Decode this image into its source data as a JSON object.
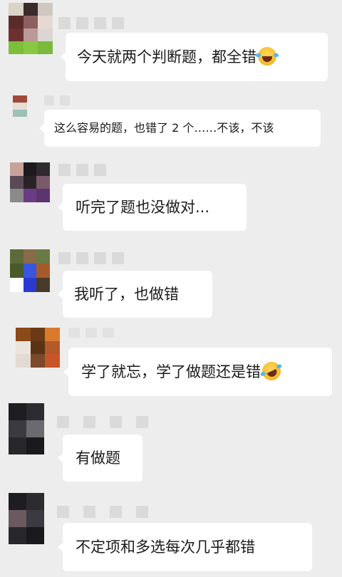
{
  "chat": {
    "messages": [
      {
        "text": "今天就两个判断题，都全错",
        "emoji": "laughing-tears-emoji"
      },
      {
        "text": "这么容易的题，也错了 2 个……不该，不该"
      },
      {
        "text": "听完了题也没做对..."
      },
      {
        "text": "我听了，也做错"
      },
      {
        "text": "学了就忘，学了做题还是错",
        "emoji": "rolling-laughing-emoji"
      },
      {
        "text": "有做题"
      },
      {
        "text": "不定项和多选每次几乎都错"
      }
    ]
  },
  "colors": {
    "background": "#ededed",
    "bubble": "#ffffff",
    "text": "#1a1a1a",
    "censored_name": "#dadada"
  }
}
